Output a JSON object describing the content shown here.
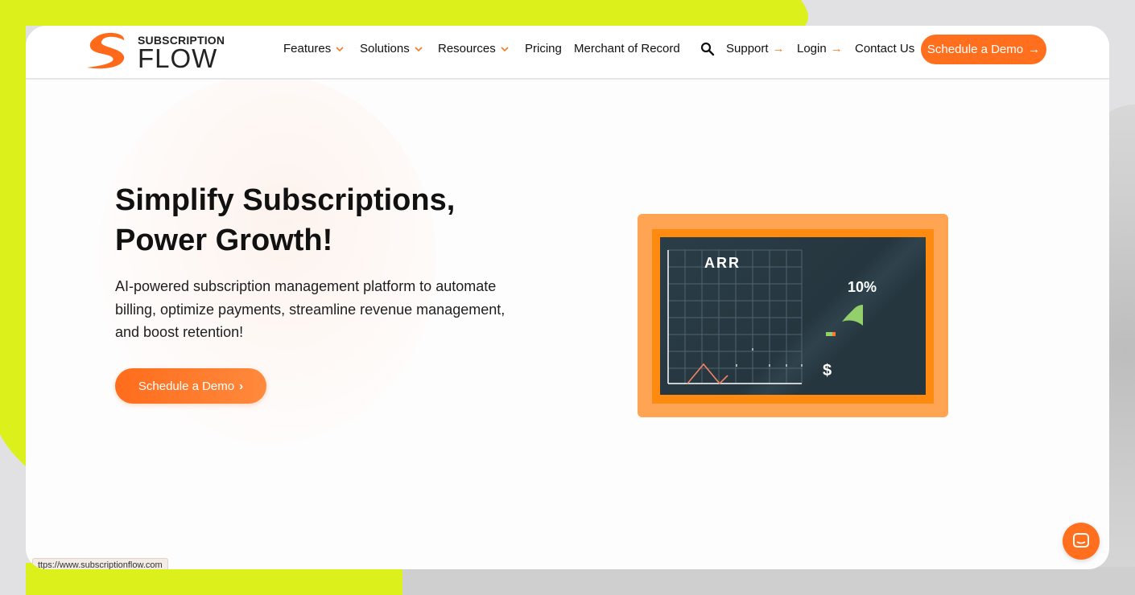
{
  "colors": {
    "accent": "#ff6f1e",
    "lime_background": "#dcf01c",
    "board": "#26363f",
    "frame": "#fea452"
  },
  "logo": {
    "line1": "SUBSCRIPTION",
    "line2": "FLOW",
    "icon": "swoosh-logo-icon"
  },
  "nav": {
    "items": [
      {
        "label": "Features",
        "dropdown": true
      },
      {
        "label": "Solutions",
        "dropdown": true
      },
      {
        "label": "Resources",
        "dropdown": true
      },
      {
        "label": "Pricing"
      },
      {
        "label": "Merchant of Record"
      },
      {
        "label": "Support",
        "arrow": true
      },
      {
        "label": "Login",
        "arrow": true
      },
      {
        "label": "Contact Us"
      }
    ],
    "search_icon": "search-icon",
    "cta_label": "Schedule a Demo"
  },
  "hero": {
    "headline_line1": "Simplify Subscriptions,",
    "headline_line2": "Power Growth!",
    "subtext": "AI-powered subscription management platform to automate billing, optimize payments, streamline revenue management, and boost retention!",
    "cta_label": "Schedule a Demo"
  },
  "illustration": {
    "chart_title": "ARR",
    "percent": "10%",
    "currency": "$"
  },
  "chat": {
    "icon": "chat-icon"
  },
  "status_bar": {
    "url": "ttps://www.subscriptionflow.com"
  }
}
